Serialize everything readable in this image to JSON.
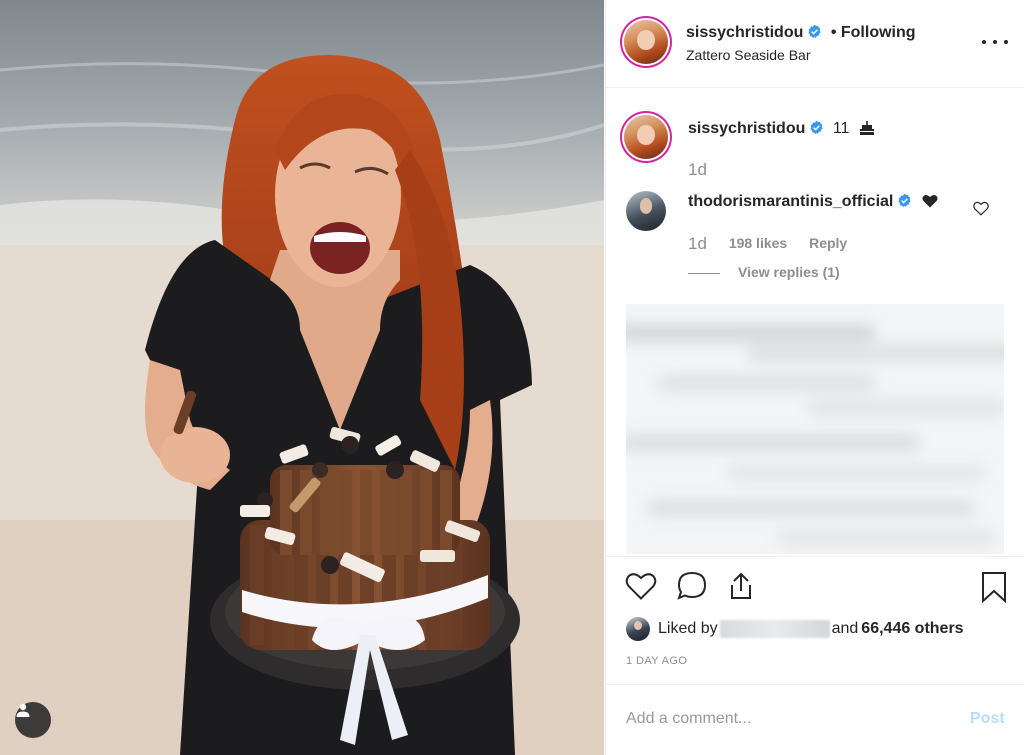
{
  "post": {
    "author": "sissychristidou",
    "follow_status": "• Following",
    "location": "Zattero Seaside Bar",
    "caption_text": "11",
    "caption_time": "1d"
  },
  "comment": {
    "author": "thodorismarantinis_official",
    "time": "1d",
    "likes": "198 likes",
    "reply": "Reply",
    "view_replies": "View replies (1)"
  },
  "actions": {
    "liked_by_prefix": "Liked by",
    "liked_by_suffix": "and",
    "others_count": "66,446 others",
    "time_ago": "1 DAY AGO"
  },
  "add_comment": {
    "placeholder": "Add a comment...",
    "post_label": "Post"
  },
  "icons": {
    "verified": "verified-badge-icon",
    "more": "more-options-icon",
    "like": "heart-icon",
    "comment": "comment-icon",
    "share": "share-icon",
    "save": "bookmark-icon",
    "tag": "user-tag-icon"
  },
  "colors": {
    "verified_blue": "#3897f0",
    "post_disabled": "#b2dffc",
    "meta_grey": "#8e8e8e",
    "text": "#262626"
  }
}
